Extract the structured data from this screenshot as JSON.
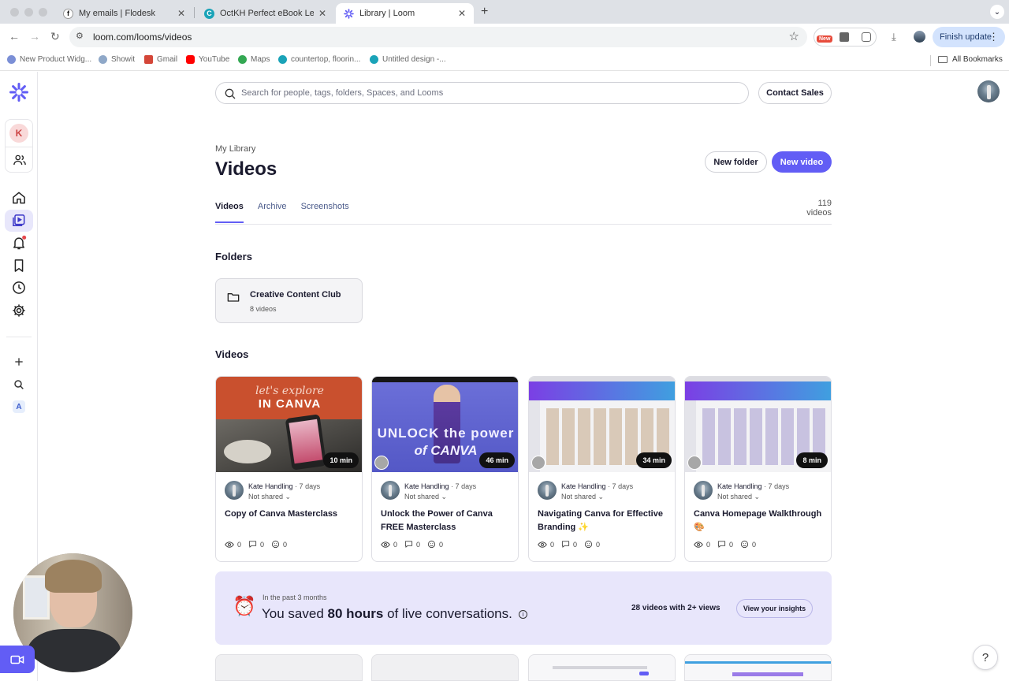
{
  "browser": {
    "tabs": [
      {
        "title": "My emails | Flodesk",
        "favicon": "f"
      },
      {
        "title": "OctKH Perfect eBook Lead M",
        "favicon": "C"
      },
      {
        "title": "Library | Loom",
        "favicon": "loom-icon"
      }
    ],
    "url": "loom.com/looms/videos",
    "ext_new_badge": "New",
    "finish_update": "Finish update",
    "bookmarks": [
      "New Product Widg...",
      "Showit",
      "Gmail",
      "YouTube",
      "Maps",
      "countertop, floorin...",
      "Untitled design -..."
    ],
    "all_bookmarks": "All Bookmarks"
  },
  "sidebar": {
    "workspace_initial": "K",
    "apps_initial": "A",
    "accent": "#625df5"
  },
  "header": {
    "search_placeholder": "Search for people, tags, folders, Spaces, and Looms",
    "contact_sales": "Contact Sales"
  },
  "page": {
    "breadcrumb": "My Library",
    "title": "Videos",
    "new_folder": "New folder",
    "new_video": "New video",
    "tabs": [
      "Videos",
      "Archive",
      "Screenshots"
    ],
    "video_count": "119 videos",
    "folders_heading": "Folders",
    "videos_heading": "Videos"
  },
  "folders": [
    {
      "name": "Creative Content Club",
      "count": "8 videos"
    }
  ],
  "videos": [
    {
      "title": "Copy of Canva Masterclass",
      "owner": "Kate Handling",
      "ago": "· 7 days",
      "sharing": "Not shared",
      "duration": "10 min",
      "views": "0",
      "comments": "0",
      "reactions": "0",
      "thumb_text_1": "let's explore",
      "thumb_text_2": "IN CANVA"
    },
    {
      "title": "Unlock the Power of Canva FREE Masterclass",
      "owner": "Kate Handling",
      "ago": "· 7 days",
      "sharing": "Not shared",
      "duration": "46 min",
      "views": "0",
      "comments": "0",
      "reactions": "0",
      "thumb_text_1": "UNLOCK the power",
      "thumb_text_2": "of CANVA"
    },
    {
      "title": "Navigating Canva for Effective Branding ✨",
      "owner": "Kate Handling",
      "ago": "· 7 days",
      "sharing": "Not shared",
      "duration": "34 min",
      "views": "0",
      "comments": "0",
      "reactions": "0"
    },
    {
      "title": "Canva Homepage Walkthrough 🎨",
      "owner": "Kate Handling",
      "ago": "· 7 days",
      "sharing": "Not shared",
      "duration": "8 min",
      "views": "0",
      "comments": "0",
      "reactions": "0"
    }
  ],
  "insights": {
    "period": "In the past 3 months",
    "saved_prefix": "You saved ",
    "saved_hours": "80 hours",
    "saved_suffix": " of live conversations.",
    "views_summary": "28 videos with 2+ views",
    "cta": "View your insights"
  },
  "help": "?"
}
